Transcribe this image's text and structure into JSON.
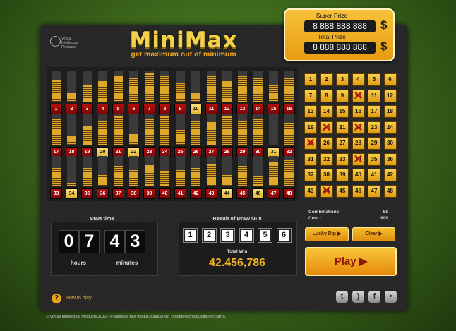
{
  "logo": {
    "brand": "MiniMax",
    "slogan": "get maximum out of minimum",
    "company_badge": "Virtual Intellectual Products"
  },
  "prize": {
    "super_label": "Super Prize",
    "super_value": "8 888 888 888",
    "total_label": "Total Prize",
    "total_value": "8 888 888 888",
    "currency": "$"
  },
  "stats": {
    "rows": [
      {
        "numbers": [
          1,
          2,
          3,
          4,
          5,
          6,
          7,
          8,
          9,
          10,
          11,
          12,
          13,
          14,
          15,
          16
        ],
        "levels": [
          0.7,
          0.28,
          0.53,
          0.68,
          0.83,
          0.78,
          0.93,
          0.85,
          0.63,
          0.28,
          0.85,
          0.68,
          0.85,
          0.78,
          0.56,
          0.78
        ],
        "highlight": [
          10
        ]
      },
      {
        "numbers": [
          17,
          18,
          19,
          20,
          21,
          22,
          23,
          24,
          25,
          26,
          27,
          28,
          29,
          30,
          31,
          32
        ],
        "levels": [
          0.85,
          0.28,
          0.6,
          0.78,
          0.93,
          0.35,
          0.85,
          0.93,
          0.48,
          0.78,
          0.75,
          0.93,
          0.78,
          0.85,
          0.0,
          0.72
        ],
        "highlight": [
          20,
          22,
          31
        ]
      },
      {
        "numbers": [
          33,
          34,
          35,
          36,
          37,
          38,
          39,
          40,
          41,
          42,
          43,
          44,
          45,
          46,
          47,
          48
        ],
        "levels": [
          0.6,
          0.12,
          0.6,
          0.38,
          0.67,
          0.53,
          0.7,
          0.48,
          0.53,
          0.6,
          0.73,
          0.38,
          0.67,
          0.35,
          0.8,
          0.88
        ],
        "highlight": [
          34,
          44,
          46
        ]
      }
    ]
  },
  "numbers_grid": {
    "columns": 6,
    "values": [
      1,
      2,
      3,
      4,
      5,
      6,
      7,
      8,
      9,
      10,
      11,
      12,
      13,
      14,
      15,
      16,
      17,
      18,
      19,
      20,
      21,
      22,
      23,
      24,
      25,
      26,
      27,
      28,
      29,
      30,
      31,
      32,
      33,
      34,
      35,
      36,
      37,
      38,
      39,
      40,
      41,
      42,
      43,
      44,
      45,
      46,
      47,
      48
    ],
    "selected": [
      10,
      20,
      22,
      25,
      34,
      44
    ]
  },
  "start_time": {
    "title": "Start time",
    "digits": [
      "0",
      "7",
      "4",
      "3"
    ],
    "hours_label": "hours",
    "minutes_label": "minutes"
  },
  "result": {
    "title": "Result of Draw № 8",
    "balls": [
      "1",
      "2",
      "3",
      "4",
      "5",
      "6"
    ],
    "total_win_label": "Total Win",
    "total_win_value": "42.456,786"
  },
  "summary": {
    "combinations_label": "Combinations:",
    "combinations_value": "50",
    "cost_label": "Cost :",
    "cost_value": "999"
  },
  "buttons": {
    "lucky_dip": "Lucky Dip ▶",
    "clear": "Clear ▶",
    "play": "Play ▶"
  },
  "help": {
    "icon": "?",
    "label": "How to play"
  },
  "social": [
    {
      "name": "twitter-icon",
      "glyph": "t"
    },
    {
      "name": "rss-icon",
      "glyph": ")"
    },
    {
      "name": "facebook-icon",
      "glyph": "f"
    },
    {
      "name": "chat-icon",
      "glyph": "•"
    }
  ],
  "footer": "© Virtual Intellectual Products 2012  -  ©  MiniMax Все права защищены. Условия использования сайта."
}
